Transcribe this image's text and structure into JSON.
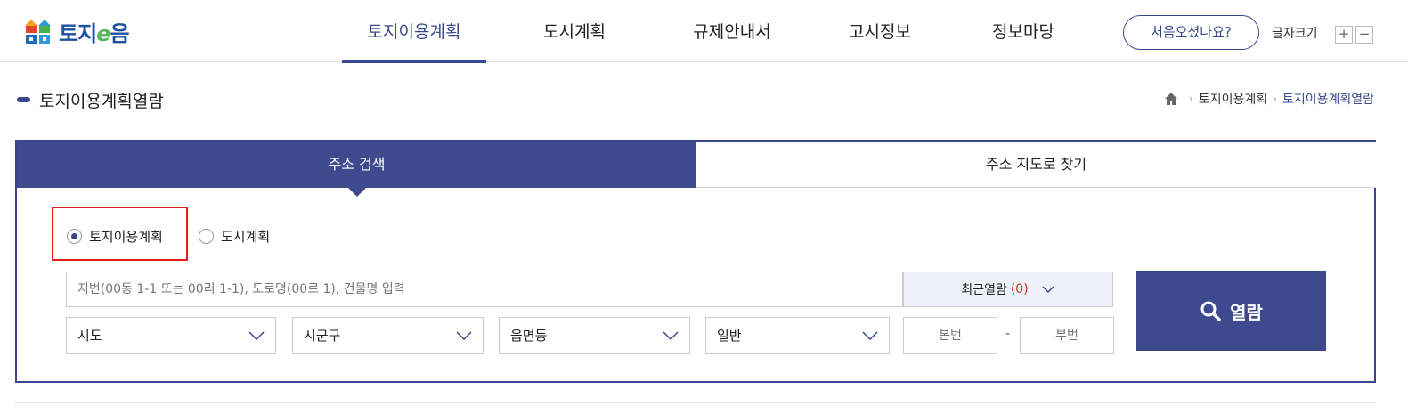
{
  "header": {
    "logo_text_prefix": "토지",
    "logo_text_e": "e",
    "logo_text_suffix": "음",
    "nav": [
      {
        "label": "토지이용계획",
        "active": true
      },
      {
        "label": "도시계획",
        "active": false
      },
      {
        "label": "규제안내서",
        "active": false
      },
      {
        "label": "고시정보",
        "active": false
      },
      {
        "label": "정보마당",
        "active": false
      }
    ],
    "first_visit_label": "처음오셨나요?",
    "font_size_label": "글자크기",
    "font_plus": "+",
    "font_minus": "−"
  },
  "page": {
    "title": "토지이용계획열람",
    "breadcrumb": [
      "토지이용계획",
      "토지이용계획열람"
    ]
  },
  "search": {
    "tabs": [
      {
        "label": "주소 검색",
        "active": true
      },
      {
        "label": "주소 지도로 찾기",
        "active": false
      }
    ],
    "radios": [
      {
        "label": "토지이용계획",
        "checked": true
      },
      {
        "label": "도시계획",
        "checked": false
      }
    ],
    "address_placeholder": "지번(00동 1-1 또는 00리 1-1), 도로명(00로 1), 건물명 입력",
    "recent_label": "최근열람",
    "recent_count": "(0)",
    "selects": [
      "시도",
      "시군구",
      "읍면동",
      "일반"
    ],
    "main_no_placeholder": "본번",
    "dash": "-",
    "sub_no_placeholder": "부번",
    "search_button_label": "열람"
  },
  "colors": {
    "primary": "#3f4a8e",
    "highlight_box": "#e01e1e",
    "count_red": "#d22222"
  }
}
